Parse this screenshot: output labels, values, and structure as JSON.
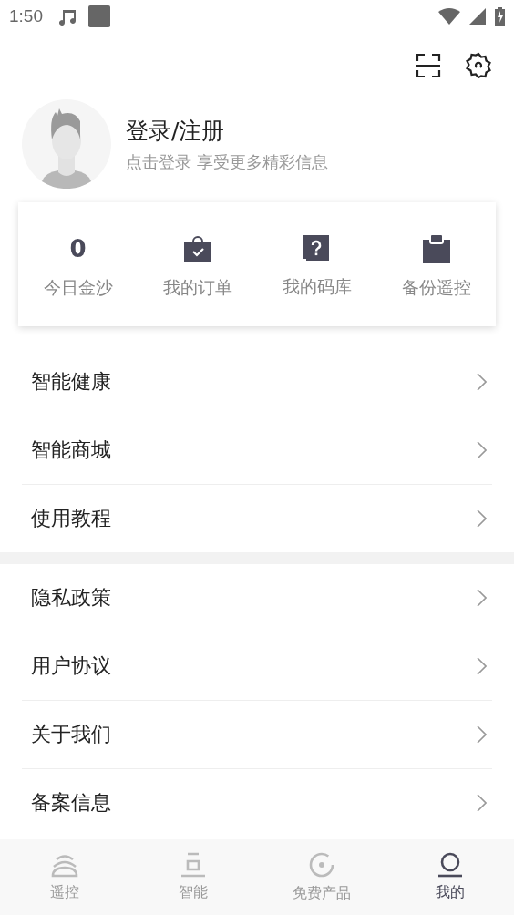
{
  "status_bar": {
    "time": "1:50"
  },
  "profile": {
    "title": "登录/注册",
    "subtitle": "点击登录 享受更多精彩信息"
  },
  "stats": [
    {
      "kind": "number",
      "value": "0",
      "label": "今日金沙"
    },
    {
      "kind": "bag",
      "label": "我的订单"
    },
    {
      "kind": "question",
      "label": "我的码库"
    },
    {
      "kind": "clipboard",
      "label": "备份遥控"
    }
  ],
  "menu_groups": [
    [
      {
        "label": "智能健康"
      },
      {
        "label": "智能商城"
      },
      {
        "label": "使用教程"
      }
    ],
    [
      {
        "label": "隐私政策"
      },
      {
        "label": "用户协议"
      },
      {
        "label": "关于我们"
      },
      {
        "label": "备案信息"
      }
    ]
  ],
  "tabs": [
    {
      "kind": "remote",
      "label": "遥控",
      "selected": false
    },
    {
      "kind": "smart",
      "label": "智能",
      "selected": false
    },
    {
      "kind": "free",
      "label": "免费产品",
      "selected": false
    },
    {
      "kind": "me",
      "label": "我的",
      "selected": true
    }
  ]
}
